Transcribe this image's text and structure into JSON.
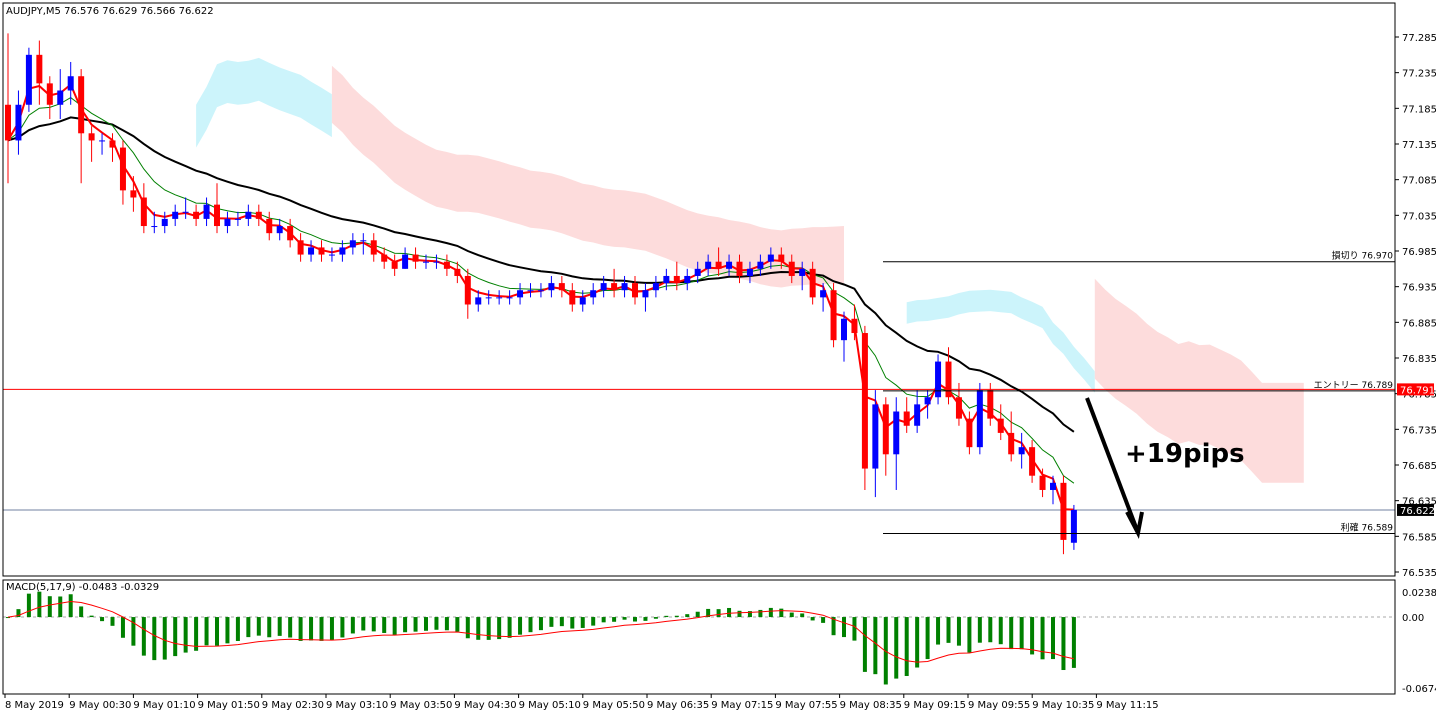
{
  "chart_data": [
    {
      "type": "candlestick",
      "header": "AUDJPY,M5  76.576 76.629 76.566 76.622",
      "symbol": "AUDJPY",
      "timeframe": "M5",
      "ohlc_last": {
        "open": 76.576,
        "high": 76.629,
        "low": 76.566,
        "close": 76.622
      },
      "ylim": [
        76.535,
        77.31
      ],
      "y_ticks": [
        "77.285",
        "77.235",
        "77.185",
        "77.135",
        "77.085",
        "77.035",
        "76.985",
        "76.935",
        "76.885",
        "76.835",
        "76.785",
        "76.735",
        "76.685",
        "76.635",
        "76.585",
        "76.535"
      ],
      "y_tick_values": [
        77.285,
        77.235,
        77.185,
        77.135,
        77.085,
        77.035,
        76.985,
        76.935,
        76.885,
        76.835,
        76.785,
        76.735,
        76.685,
        76.635,
        76.585,
        76.535
      ],
      "x_ticks": [
        "8 May 2019",
        "9 May 00:30",
        "9 May 01:10",
        "9 May 01:50",
        "9 May 02:30",
        "9 May 03:10",
        "9 May 03:50",
        "9 May 04:30",
        "9 May 05:10",
        "9 May 05:50",
        "9 May 06:35",
        "9 May 07:15",
        "9 May 07:55",
        "9 May 08:35",
        "9 May 09:15",
        "9 May 09:55",
        "9 May 10:35",
        "9 May 11:15"
      ],
      "candles": [
        [
          77.19,
          77.29,
          77.08,
          77.14
        ],
        [
          77.14,
          77.21,
          77.12,
          77.19
        ],
        [
          77.19,
          77.27,
          77.18,
          77.26
        ],
        [
          77.26,
          77.28,
          77.19,
          77.22
        ],
        [
          77.22,
          77.23,
          77.17,
          77.19
        ],
        [
          77.19,
          77.24,
          77.17,
          77.21
        ],
        [
          77.21,
          77.25,
          77.19,
          77.23
        ],
        [
          77.23,
          77.24,
          77.08,
          77.15
        ],
        [
          77.15,
          77.16,
          77.11,
          77.14
        ],
        [
          77.14,
          77.15,
          77.12,
          77.14
        ],
        [
          77.14,
          77.15,
          77.11,
          77.13
        ],
        [
          77.13,
          77.14,
          77.05,
          77.07
        ],
        [
          77.07,
          77.09,
          77.04,
          77.06
        ],
        [
          77.06,
          77.08,
          77.01,
          77.02
        ],
        [
          77.02,
          77.04,
          77.01,
          77.02
        ],
        [
          77.02,
          77.04,
          77.01,
          77.03
        ],
        [
          77.03,
          77.05,
          77.02,
          77.04
        ],
        [
          77.04,
          77.06,
          77.03,
          77.04
        ],
        [
          77.04,
          77.05,
          77.02,
          77.03
        ],
        [
          77.03,
          77.06,
          77.02,
          77.05
        ],
        [
          77.05,
          77.08,
          77.01,
          77.02
        ],
        [
          77.02,
          77.04,
          77.01,
          77.03
        ],
        [
          77.03,
          77.04,
          77.02,
          77.03
        ],
        [
          77.03,
          77.05,
          77.02,
          77.04
        ],
        [
          77.04,
          77.05,
          77.02,
          77.03
        ],
        [
          77.03,
          77.04,
          77.0,
          77.01
        ],
        [
          77.01,
          77.03,
          77.0,
          77.02
        ],
        [
          77.02,
          77.03,
          76.99,
          77.0
        ],
        [
          77.0,
          77.01,
          76.97,
          76.98
        ],
        [
          76.98,
          77.0,
          76.97,
          76.99
        ],
        [
          76.99,
          77.0,
          76.97,
          76.98
        ],
        [
          76.98,
          76.99,
          76.97,
          76.98
        ],
        [
          76.98,
          77.0,
          76.97,
          76.99
        ],
        [
          76.99,
          77.01,
          76.98,
          77.0
        ],
        [
          77.0,
          77.01,
          76.98,
          77.0
        ],
        [
          77.0,
          77.01,
          76.97,
          76.98
        ],
        [
          76.98,
          76.99,
          76.96,
          76.97
        ],
        [
          76.97,
          76.98,
          76.95,
          76.96
        ],
        [
          76.96,
          76.99,
          76.96,
          76.98
        ],
        [
          76.98,
          76.99,
          76.96,
          76.97
        ],
        [
          76.97,
          76.98,
          76.96,
          76.97
        ],
        [
          76.97,
          76.98,
          76.96,
          76.97
        ],
        [
          76.97,
          76.98,
          76.95,
          76.96
        ],
        [
          76.96,
          76.97,
          76.94,
          76.95
        ],
        [
          76.95,
          76.96,
          76.89,
          76.91
        ],
        [
          76.91,
          76.93,
          76.9,
          76.92
        ],
        [
          76.92,
          76.93,
          76.91,
          76.92
        ],
        [
          76.92,
          76.93,
          76.91,
          76.92
        ],
        [
          76.92,
          76.93,
          76.91,
          76.92
        ],
        [
          76.92,
          76.94,
          76.91,
          76.93
        ],
        [
          76.93,
          76.94,
          76.92,
          76.93
        ],
        [
          76.93,
          76.94,
          76.92,
          76.93
        ],
        [
          76.93,
          76.95,
          76.92,
          76.94
        ],
        [
          76.94,
          76.95,
          76.92,
          76.93
        ],
        [
          76.93,
          76.94,
          76.9,
          76.91
        ],
        [
          76.91,
          76.93,
          76.9,
          76.92
        ],
        [
          76.92,
          76.94,
          76.91,
          76.93
        ],
        [
          76.93,
          76.95,
          76.92,
          76.94
        ],
        [
          76.94,
          76.96,
          76.92,
          76.93
        ],
        [
          76.93,
          76.95,
          76.92,
          76.94
        ],
        [
          76.94,
          76.95,
          76.91,
          76.92
        ],
        [
          76.92,
          76.94,
          76.9,
          76.93
        ],
        [
          76.93,
          76.95,
          76.92,
          76.94
        ],
        [
          76.94,
          76.96,
          76.93,
          76.95
        ],
        [
          76.95,
          76.97,
          76.93,
          76.94
        ],
        [
          76.94,
          76.96,
          76.93,
          76.95
        ],
        [
          76.95,
          76.97,
          76.94,
          76.96
        ],
        [
          76.96,
          76.98,
          76.95,
          76.97
        ],
        [
          76.97,
          76.99,
          76.95,
          76.96
        ],
        [
          76.96,
          76.98,
          76.95,
          76.97
        ],
        [
          76.97,
          76.98,
          76.94,
          76.95
        ],
        [
          76.95,
          76.97,
          76.94,
          76.96
        ],
        [
          76.96,
          76.98,
          76.95,
          76.97
        ],
        [
          76.97,
          76.99,
          76.96,
          76.98
        ],
        [
          76.98,
          76.99,
          76.96,
          76.97
        ],
        [
          76.97,
          76.98,
          76.94,
          76.95
        ],
        [
          76.95,
          76.97,
          76.93,
          76.96
        ],
        [
          76.96,
          76.97,
          76.91,
          76.92
        ],
        [
          76.92,
          76.94,
          76.9,
          76.93
        ],
        [
          76.93,
          76.94,
          76.85,
          76.86
        ],
        [
          76.86,
          76.9,
          76.83,
          76.89
        ],
        [
          76.89,
          76.91,
          76.86,
          76.87
        ],
        [
          76.87,
          76.88,
          76.65,
          76.68
        ],
        [
          76.68,
          76.79,
          76.64,
          76.77
        ],
        [
          76.77,
          76.78,
          76.67,
          76.7
        ],
        [
          76.7,
          76.78,
          76.65,
          76.76
        ],
        [
          76.76,
          76.78,
          76.73,
          76.74
        ],
        [
          76.74,
          76.79,
          76.73,
          76.77
        ],
        [
          76.77,
          76.79,
          76.75,
          76.78
        ],
        [
          76.78,
          76.84,
          76.77,
          76.83
        ],
        [
          76.83,
          76.85,
          76.77,
          76.78
        ],
        [
          76.78,
          76.8,
          76.74,
          76.75
        ],
        [
          76.75,
          76.76,
          76.7,
          76.71
        ],
        [
          76.71,
          76.8,
          76.7,
          76.79
        ],
        [
          76.79,
          76.8,
          76.74,
          76.75
        ],
        [
          76.75,
          76.77,
          76.72,
          76.73
        ],
        [
          76.73,
          76.76,
          76.69,
          76.7
        ],
        [
          76.7,
          76.73,
          76.68,
          76.71
        ],
        [
          76.71,
          76.72,
          76.66,
          76.67
        ],
        [
          76.67,
          76.68,
          76.64,
          76.65
        ],
        [
          76.65,
          76.67,
          76.63,
          76.66
        ],
        [
          76.66,
          76.67,
          76.56,
          76.58
        ],
        [
          76.576,
          76.629,
          76.566,
          76.622
        ]
      ],
      "levels": [
        {
          "label": "損切り 76.970",
          "value": 76.97
        },
        {
          "label": "エントリー 76.789",
          "value": 76.789
        },
        {
          "label": "利確 76.589",
          "value": 76.589
        }
      ],
      "price_tags": [
        {
          "label": "76.791",
          "value": 76.791,
          "color": "#ff0000"
        },
        {
          "label": "76.622",
          "value": 76.622,
          "color": "#000000"
        }
      ],
      "annotation": "+19pips",
      "colors": {
        "bull": "#0000ff",
        "bear": "#ff0000",
        "sma": "#000000",
        "ema_fast": "#ff0000",
        "ema_slow": "#008000",
        "kumo_bull": "#ccf4fb",
        "kumo_bear": "#fddcdc"
      }
    },
    {
      "type": "histogram",
      "label": "MACD(5,17,9) -0.0483 -0.0329",
      "ylim": [
        -0.0674,
        0.0238
      ],
      "y_ticks": [
        "0.0238",
        "0.00",
        "-0.0674"
      ],
      "y_tick_values": [
        0.0238,
        0.0,
        -0.0674
      ],
      "macd_last": -0.0483,
      "signal_last": -0.0329,
      "colors": {
        "histogram": "#008000",
        "signal": "#ff0000"
      }
    }
  ]
}
